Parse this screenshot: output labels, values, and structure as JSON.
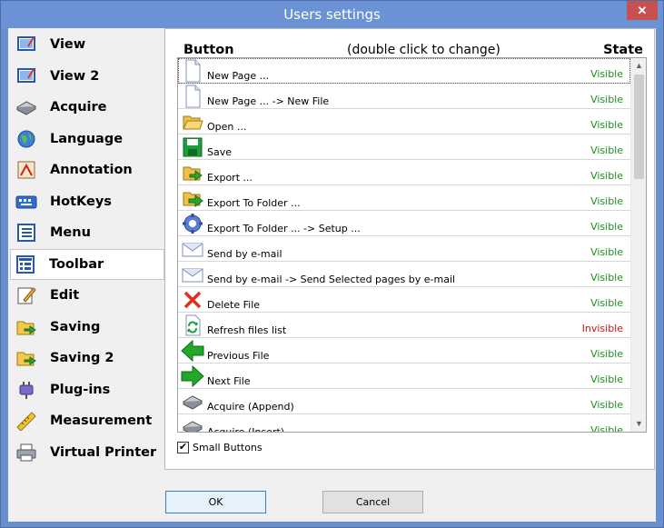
{
  "window": {
    "title": "Users settings",
    "close_glyph": "✕"
  },
  "sidebar": {
    "items": [
      {
        "label": "View",
        "icon": "view-icon"
      },
      {
        "label": "View 2",
        "icon": "view-icon"
      },
      {
        "label": "Acquire",
        "icon": "scanner-icon"
      },
      {
        "label": "Language",
        "icon": "globe-icon"
      },
      {
        "label": "Annotation",
        "icon": "annotation-icon"
      },
      {
        "label": "HotKeys",
        "icon": "keyboard-icon"
      },
      {
        "label": "Menu",
        "icon": "menu-icon"
      },
      {
        "label": "Toolbar",
        "icon": "toolbar-icon",
        "active": true
      },
      {
        "label": "Edit",
        "icon": "edit-icon"
      },
      {
        "label": "Saving",
        "icon": "saving-icon"
      },
      {
        "label": "Saving 2",
        "icon": "saving-icon"
      },
      {
        "label": "Plug-ins",
        "icon": "plugin-icon"
      },
      {
        "label": "Measurement",
        "icon": "ruler-icon"
      },
      {
        "label": "Virtual Printer",
        "icon": "printer-icon"
      }
    ]
  },
  "panel": {
    "header_button": "Button",
    "header_hint": "(double click to change)",
    "header_state": "State",
    "rows": [
      {
        "label": "New Page ...",
        "state": "Visible",
        "icon": "new-page-icon"
      },
      {
        "label": "New Page ... -> New File",
        "state": "Visible",
        "icon": "new-page-icon"
      },
      {
        "label": "Open ...",
        "state": "Visible",
        "icon": "open-folder-icon"
      },
      {
        "label": "Save",
        "state": "Visible",
        "icon": "save-icon"
      },
      {
        "label": "Export ...",
        "state": "Visible",
        "icon": "export-icon"
      },
      {
        "label": "Export To Folder ...",
        "state": "Visible",
        "icon": "export-folder-icon"
      },
      {
        "label": "Export To Folder ... -> Setup ...",
        "state": "Visible",
        "icon": "gear-icon"
      },
      {
        "label": "Send by e-mail",
        "state": "Visible",
        "icon": "email-icon"
      },
      {
        "label": "Send by e-mail -> Send Selected pages by e-mail",
        "state": "Visible",
        "icon": "email-icon"
      },
      {
        "label": "Delete File",
        "state": "Visible",
        "icon": "delete-icon"
      },
      {
        "label": "Refresh files list",
        "state": "Invisible",
        "icon": "refresh-icon"
      },
      {
        "label": "Previous File",
        "state": "Visible",
        "icon": "arrow-left-icon"
      },
      {
        "label": "Next File",
        "state": "Visible",
        "icon": "arrow-right-icon"
      },
      {
        "label": "Acquire (Append)",
        "state": "Visible",
        "icon": "scanner-icon"
      },
      {
        "label": "Acquire (Insert)",
        "state": "Visible",
        "icon": "scanner-icon"
      }
    ],
    "small_buttons_label": "Small Buttons",
    "small_buttons_checked": true
  },
  "footer": {
    "ok_label": "OK",
    "cancel_label": "Cancel"
  },
  "colors": {
    "visible": "#1a8f1a",
    "invisible": "#d01010",
    "titlebar": "#6b92d4"
  }
}
